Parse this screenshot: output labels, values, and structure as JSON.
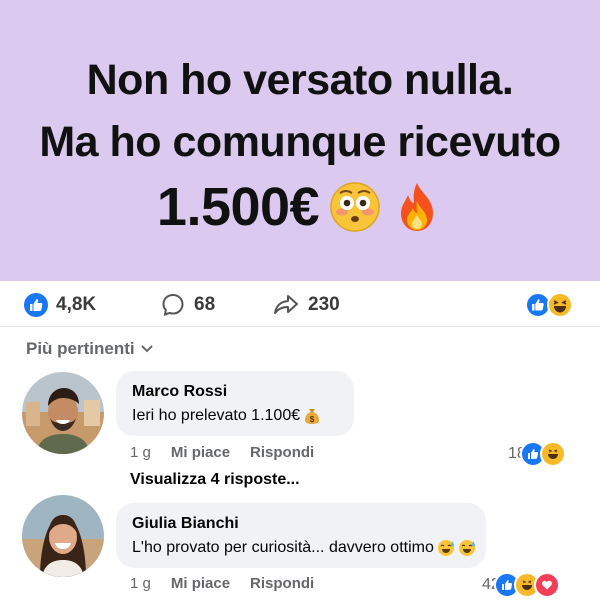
{
  "banner": {
    "line1": "Non ho versato nulla.",
    "line2": "Ma ho comunque ricevuto",
    "amount": "1.500€",
    "emojis": [
      "flushed-face",
      "fire"
    ]
  },
  "stats": {
    "likes": "4,8K",
    "comments": "68",
    "shares": "230"
  },
  "sort_label": "Più pertinenti",
  "comments": [
    {
      "author": "Marco Rossi",
      "text": "Ieri ho prelevato 1.100€",
      "emoji": "money-bag",
      "time": "1 g",
      "like_label": "Mi piace",
      "reply_label": "Rispondi",
      "reaction_count": "18",
      "reactions": [
        "like",
        "haha"
      ],
      "view_replies": "Visualizza 4 risposte..."
    },
    {
      "author": "Giulia Bianchi",
      "text": "L'ho provato per curiosità... davvero ottimo",
      "emoji": "sweat-smile x2",
      "time": "1 g",
      "like_label": "Mi piace",
      "reply_label": "Rispondi",
      "reaction_count": "42",
      "reactions": [
        "like",
        "haha",
        "love"
      ]
    }
  ],
  "colors": {
    "banner_bg": "#dcc9f0",
    "like_blue": "#1877f2",
    "haha_yellow": "#f7b928",
    "love_red": "#f33e58"
  }
}
